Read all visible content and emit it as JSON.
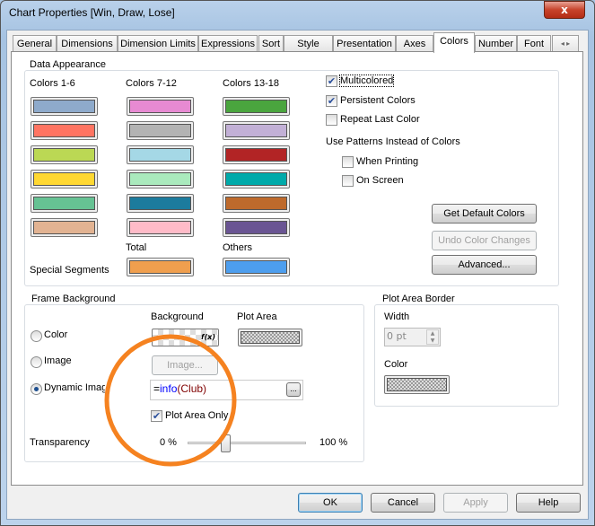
{
  "window": {
    "title": "Chart Properties [Win, Draw, Lose]",
    "close_glyph": "x"
  },
  "tabs": [
    "General",
    "Dimensions",
    "Dimension Limits",
    "Expressions",
    "Sort",
    "Style",
    "Presentation",
    "Axes",
    "Colors",
    "Number",
    "Font"
  ],
  "selected_tab": "Colors",
  "data_appearance": {
    "label": "Data Appearance",
    "col1_label": "Colors 1-6",
    "col2_label": "Colors 7-12",
    "col3_label": "Colors 13-18",
    "colors_1_6": [
      "#8eaacb",
      "#ff7462",
      "#bbd854",
      "#ffd832",
      "#66c293",
      "#e2b392"
    ],
    "colors_7_12": [
      "#e78ad2",
      "#b3b3b3",
      "#a5d8e6",
      "#aaeabd",
      "#1c7b9d",
      "#ffbbc8"
    ],
    "colors_13_18": [
      "#4aa53e",
      "#c2b0d6",
      "#b22425",
      "#00aaaa",
      "#be6a2c",
      "#6a5593"
    ],
    "special_segments_label": "Special Segments",
    "total_label": "Total",
    "others_label": "Others",
    "total_color": "#f09f4e",
    "others_color": "#4d9eee",
    "multicolored": {
      "label": "Multicolored",
      "checked": true
    },
    "persistent": {
      "label": "Persistent Colors",
      "checked": true
    },
    "repeat_last": {
      "label": "Repeat Last Color",
      "checked": false
    },
    "patterns_label": "Use Patterns Instead of Colors",
    "when_printing": {
      "label": "When Printing",
      "checked": false
    },
    "on_screen": {
      "label": "On Screen",
      "checked": false
    },
    "get_default": "Get Default Colors",
    "undo": "Undo Color Changes",
    "advanced": "Advanced..."
  },
  "frame_background": {
    "label": "Frame Background",
    "background_label": "Background",
    "plot_area_label": "Plot Area",
    "fx": "f(x)",
    "radio_color": "Color",
    "radio_image": "Image",
    "radio_dynamic": "Dynamic Imag",
    "selected": "Dynamic Image",
    "image_button": "Image...",
    "expression_prefix": "=",
    "expression_func": "info",
    "expression_args": "(Club)",
    "browse": "...",
    "plot_area_only": {
      "label": "Plot Area Only",
      "checked": true
    },
    "transparency_label": "Transparency",
    "min": "0 %",
    "max": "100 %",
    "transparency_percent": 32
  },
  "plot_area_border": {
    "label": "Plot Area Border",
    "width_label": "Width",
    "width_value": "0 pt",
    "color_label": "Color"
  },
  "annotation_color": "#f58220",
  "footer": {
    "ok": "OK",
    "cancel": "Cancel",
    "apply": "Apply",
    "help": "Help"
  }
}
